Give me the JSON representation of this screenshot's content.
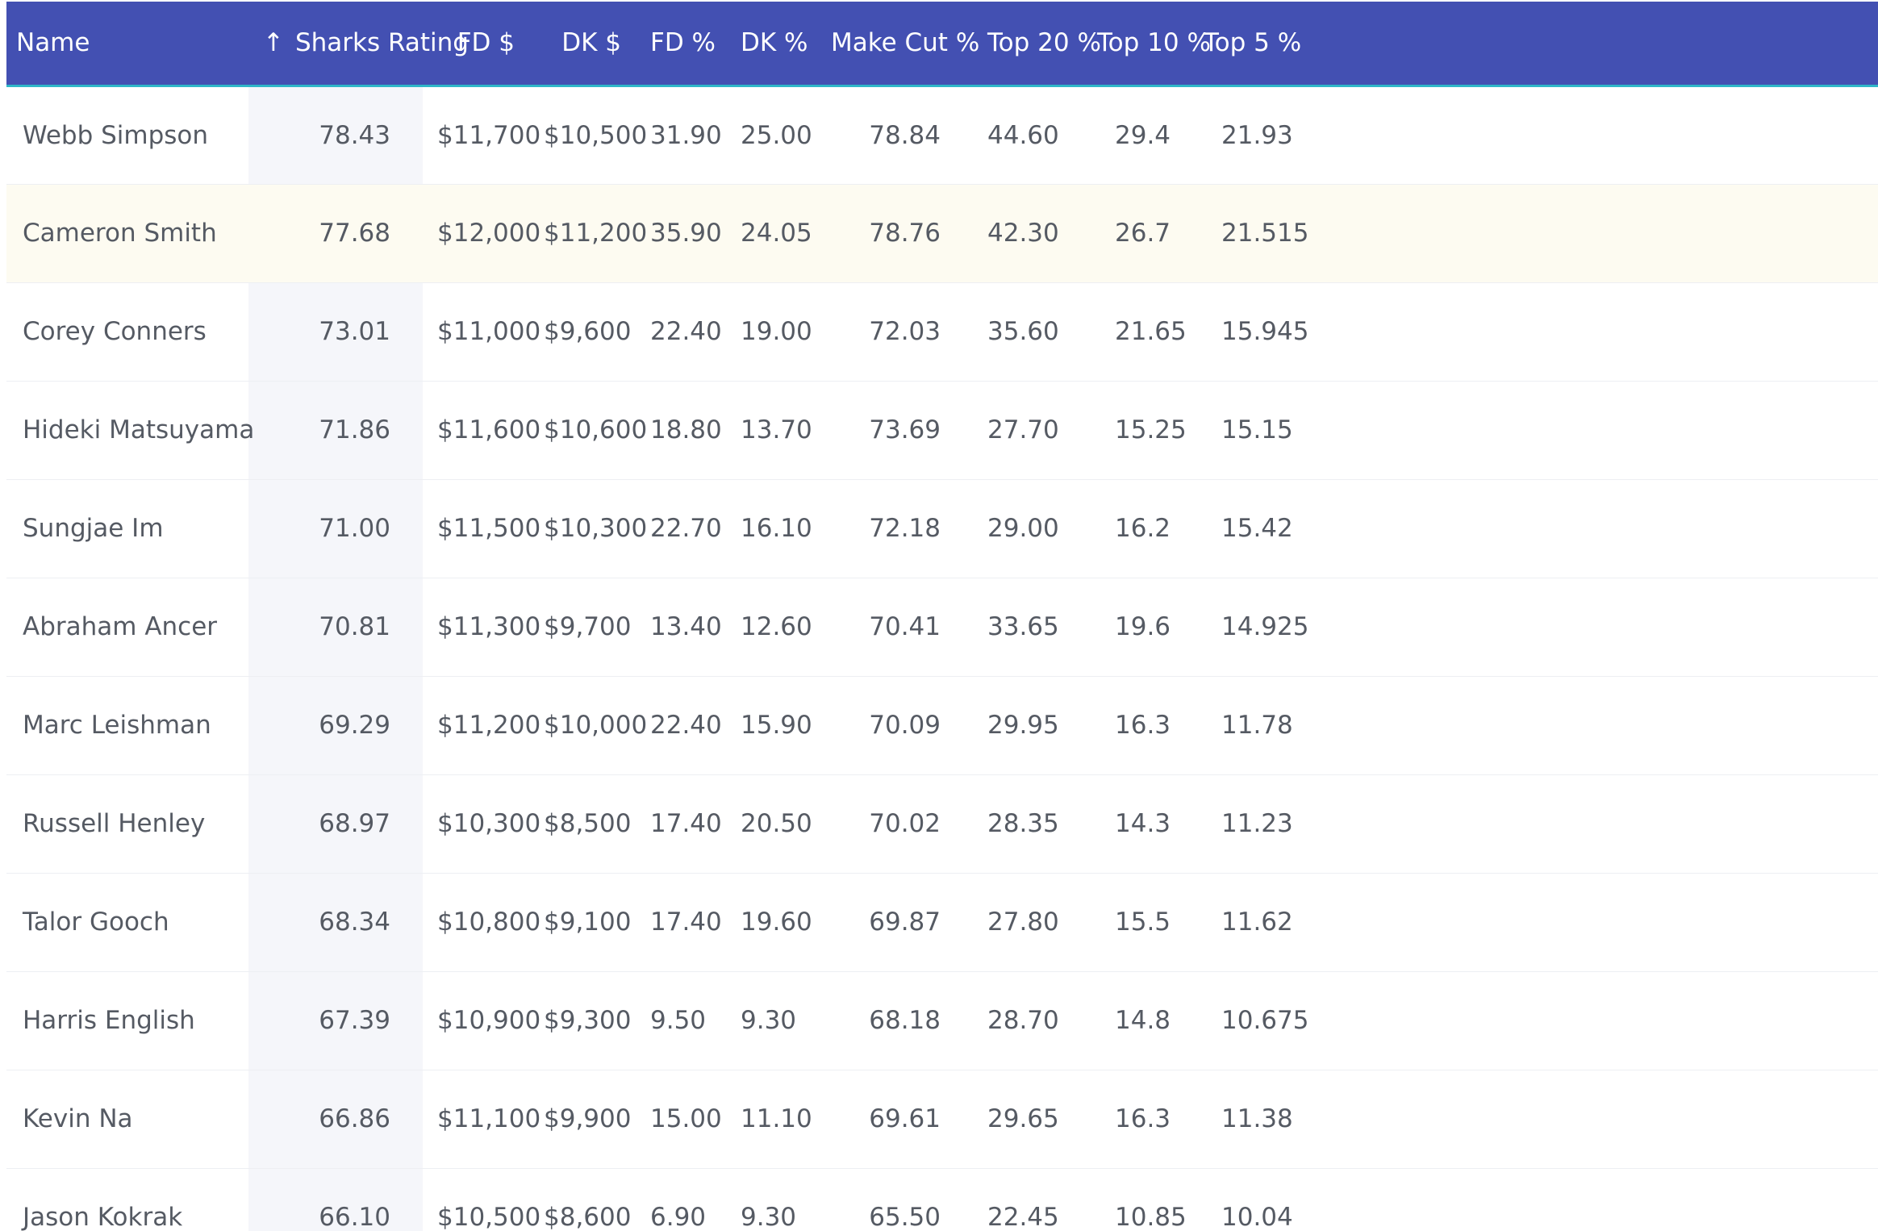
{
  "table": {
    "sort_arrow": "↑",
    "columns": [
      "Name",
      "Sharks Rating",
      "FD $",
      "DK $",
      "FD %",
      "DK %",
      "Make Cut %",
      "Top 20 %",
      "Top 10 %",
      "Top 5 %"
    ],
    "rows": [
      [
        "Webb Simpson",
        "78.43",
        "$11,700",
        "$10,500",
        "31.90",
        "25.00",
        "78.84",
        "44.60",
        "29.4",
        "21.93"
      ],
      [
        "Cameron Smith",
        "77.68",
        "$12,000",
        "$11,200",
        "35.90",
        "24.05",
        "78.76",
        "42.30",
        "26.7",
        "21.515"
      ],
      [
        "Corey Conners",
        "73.01",
        "$11,000",
        "$9,600",
        "22.40",
        "19.00",
        "72.03",
        "35.60",
        "21.65",
        "15.945"
      ],
      [
        "Hideki Matsuyama",
        "71.86",
        "$11,600",
        "$10,600",
        "18.80",
        "13.70",
        "73.69",
        "27.70",
        "15.25",
        "15.15"
      ],
      [
        "Sungjae Im",
        "71.00",
        "$11,500",
        "$10,300",
        "22.70",
        "16.10",
        "72.18",
        "29.00",
        "16.2",
        "15.42"
      ],
      [
        "Abraham Ancer",
        "70.81",
        "$11,300",
        "$9,700",
        "13.40",
        "12.60",
        "70.41",
        "33.65",
        "19.6",
        "14.925"
      ],
      [
        "Marc Leishman",
        "69.29",
        "$11,200",
        "$10,000",
        "22.40",
        "15.90",
        "70.09",
        "29.95",
        "16.3",
        "11.78"
      ],
      [
        "Russell Henley",
        "68.97",
        "$10,300",
        "$8,500",
        "17.40",
        "20.50",
        "70.02",
        "28.35",
        "14.3",
        "11.23"
      ],
      [
        "Talor Gooch",
        "68.34",
        "$10,800",
        "$9,100",
        "17.40",
        "19.60",
        "69.87",
        "27.80",
        "15.5",
        "11.62"
      ],
      [
        "Harris English",
        "67.39",
        "$10,900",
        "$9,300",
        "9.50",
        "9.30",
        "68.18",
        "28.70",
        "14.8",
        "10.675"
      ],
      [
        "Kevin Na",
        "66.86",
        "$11,100",
        "$9,900",
        "15.00",
        "11.10",
        "69.61",
        "29.65",
        "16.3",
        "11.38"
      ],
      [
        "Jason Kokrak",
        "66.10",
        "$10,500",
        "$8,600",
        "6.90",
        "9.30",
        "65.50",
        "22.45",
        "10.85",
        "10.04"
      ]
    ],
    "highlighted_row": 1,
    "colors": {
      "header_bg": "#4350b2",
      "header_accent": "#2fb6c8",
      "sorted_column_bg": "#f5f6fa",
      "highlight_row_bg": "#fdfbf1"
    }
  }
}
